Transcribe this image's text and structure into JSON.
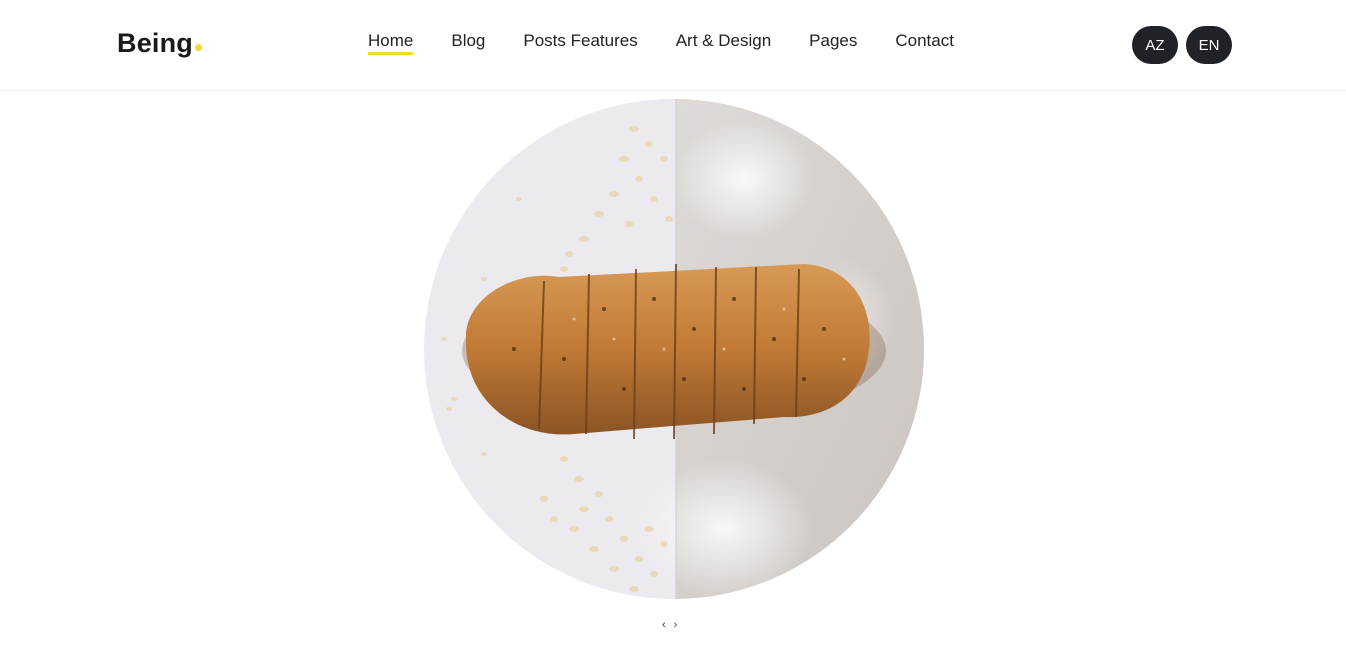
{
  "header": {
    "logo": "Being",
    "nav": [
      "Home",
      "Blog",
      "Posts Features",
      "Art & Design",
      "Pages",
      "Contact"
    ],
    "active_nav": "Home",
    "languages": [
      "AZ",
      "EN"
    ]
  },
  "hero": {
    "image": "bread-loaf-photo",
    "prev_label": "‹",
    "next_label": "›"
  },
  "colors": {
    "accent": "#f2d63a",
    "lang_bg": "#1f2226",
    "text": "#222222"
  }
}
